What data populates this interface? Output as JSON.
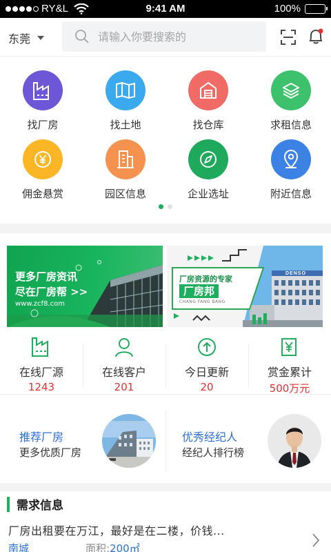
{
  "status_bar": {
    "carrier": "RY&L",
    "time": "9:41 AM",
    "battery": "100%"
  },
  "header": {
    "city": "东莞",
    "search_placeholder": "请输入你要搜索的"
  },
  "categories": [
    {
      "label": "找厂房",
      "icon": "factory-icon",
      "color": "#6d57d6"
    },
    {
      "label": "找土地",
      "icon": "map-icon",
      "color": "#3aa9ee"
    },
    {
      "label": "找仓库",
      "icon": "warehouse-icon",
      "color": "#f06a66"
    },
    {
      "label": "求租信息",
      "icon": "layers-icon",
      "color": "#3ec16c"
    },
    {
      "label": "佣金悬赏",
      "icon": "yen-coin-icon",
      "color": "#fbb626"
    },
    {
      "label": "园区信息",
      "icon": "building-icon",
      "color": "#f6924f"
    },
    {
      "label": "企业选址",
      "icon": "compass-icon",
      "color": "#1fa95c"
    },
    {
      "label": "附近信息",
      "icon": "location-pin-icon",
      "color": "#3b82e4"
    }
  ],
  "banners": {
    "left": {
      "line1": "更多厂房资讯",
      "line2": "尽在厂房帮 >>",
      "url": "www.zcf8.com"
    },
    "right": {
      "tagline": "厂房资源的专家",
      "brand": "厂房邦",
      "brand_pinyin": "CHANG FANG BANG",
      "building_sign": "DENSO"
    }
  },
  "stats": [
    {
      "label": "在线厂源",
      "value": "1243",
      "icon": "factory-outline-icon"
    },
    {
      "label": "在线客户",
      "value": "201",
      "icon": "user-outline-icon"
    },
    {
      "label": "今日更新",
      "value": "20",
      "icon": "arrow-up-circle-icon"
    },
    {
      "label": "赏金累计",
      "value": "500万元",
      "icon": "yen-doc-icon"
    }
  ],
  "promos": [
    {
      "title": "推荐厂房",
      "subtitle": "更多优质厂房"
    },
    {
      "title": "优秀经纪人",
      "subtitle": "经纪人排行榜"
    }
  ],
  "demand": {
    "section_title": "需求信息",
    "item_text": "厂房出租要在万江，最好是在二楼，价钱...",
    "location": "南城",
    "area_label": "面积:",
    "area_value": "200㎡"
  },
  "colors": {
    "brand_green": "#1fae5e",
    "link_blue": "#2a6fd8",
    "stat_red": "#e13232"
  }
}
